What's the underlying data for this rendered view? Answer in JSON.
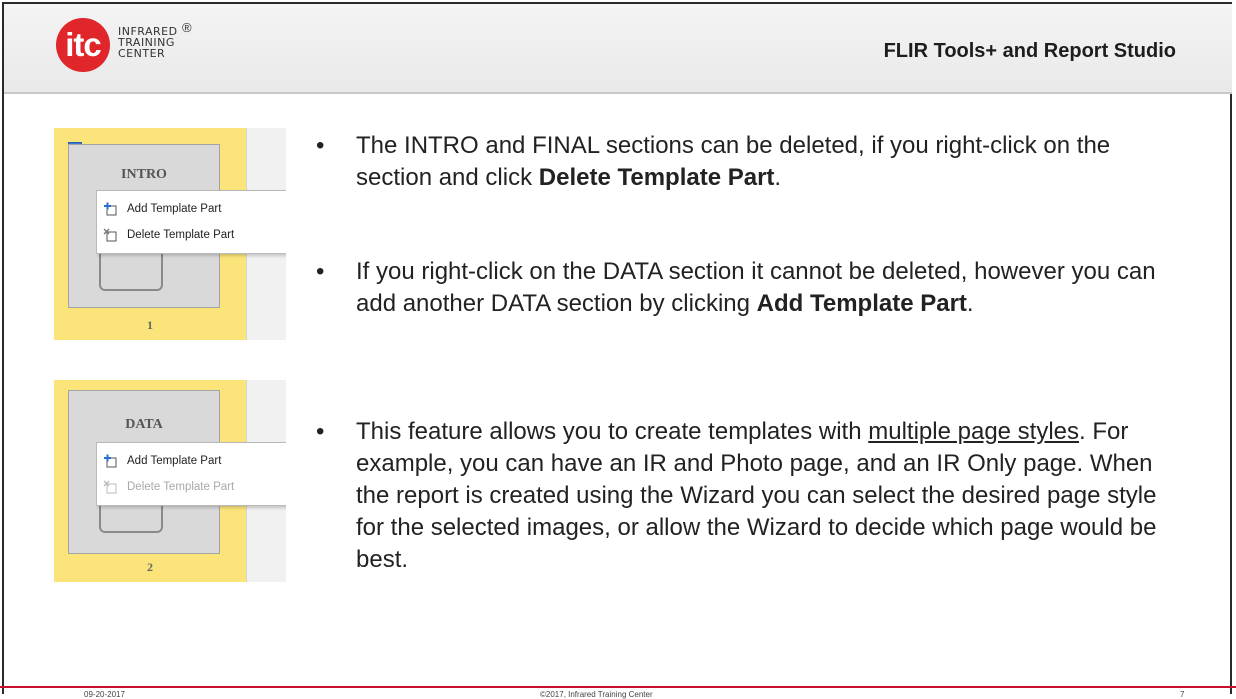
{
  "header": {
    "logo_mark": "itc",
    "logo_lines": [
      "INFRARED",
      "TRAINING",
      "CENTER"
    ],
    "logo_reg": "®",
    "title": "FLIR Tools+ and Report Studio"
  },
  "panels": [
    {
      "section_label": "INTRO",
      "page_number": "1",
      "checked": true,
      "menu": [
        {
          "label": "Add Template Part",
          "icon": "add-part-icon",
          "enabled": true
        },
        {
          "label": "Delete Template Part",
          "icon": "delete-part-icon",
          "enabled": true
        }
      ]
    },
    {
      "section_label": "DATA",
      "page_number": "2",
      "checked": false,
      "menu": [
        {
          "label": "Add Template Part",
          "icon": "add-part-icon",
          "enabled": true
        },
        {
          "label": "Delete Template Part",
          "icon": "delete-part-icon",
          "enabled": false
        }
      ]
    }
  ],
  "bullets": [
    {
      "bullet": "•",
      "pre": "The INTRO and FINAL sections can be deleted, if you right-click on the section and click ",
      "bold": "Delete Template Part",
      "post": "."
    },
    {
      "bullet": "•",
      "pre": "If you right-click on the DATA section it cannot be deleted, however you can add another DATA section by clicking ",
      "bold": "Add Template Part",
      "post": "."
    },
    {
      "bullet": "•",
      "pre": "This feature allows you to create templates with ",
      "underline": "multiple page styles",
      "post": ".  For example, you can have an IR and Photo page, and an IR Only page.  When the report is created using the Wizard you can select the desired page style for the selected images, or allow the Wizard to decide which page would be best."
    }
  ],
  "footer": {
    "date": "09-20-2017",
    "copyright": "©2017, Infrared Training Center",
    "page": "7"
  },
  "colors": {
    "brand_red": "#e0252b",
    "panel_yellow": "#fbe57a",
    "checkbox_blue": "#3b78d8"
  }
}
